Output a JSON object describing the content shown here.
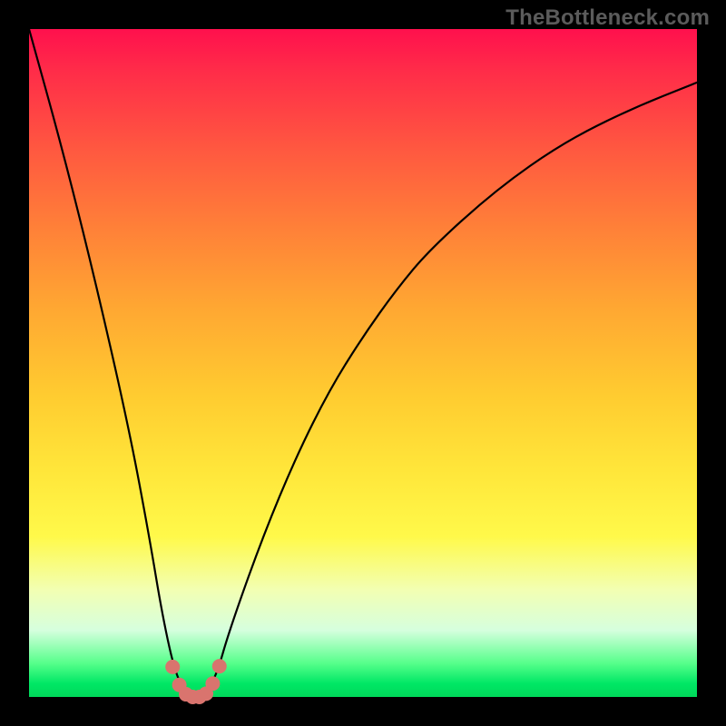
{
  "watermark_text": "TheBottleneck.com",
  "plot": {
    "background_frame_color": "#000000",
    "gradient_top_color": "#ff104d",
    "gradient_mid_color": "#ffe63a",
    "gradient_bottom_color": "#00d85a",
    "curve_color": "#000000",
    "marker_color": "#d9746e"
  },
  "chart_data": {
    "type": "line",
    "title": "",
    "xlabel": "",
    "ylabel": "",
    "x": [
      0.0,
      0.05,
      0.1,
      0.15,
      0.18,
      0.2,
      0.22,
      0.24,
      0.25,
      0.26,
      0.28,
      0.3,
      0.35,
      0.4,
      0.45,
      0.5,
      0.55,
      0.6,
      0.7,
      0.8,
      0.9,
      1.0
    ],
    "y_percent_bottleneck": [
      100,
      82,
      62,
      40,
      24,
      12,
      3,
      0,
      0,
      0,
      3,
      10,
      24,
      36,
      46,
      54,
      61,
      67,
      76,
      83,
      88,
      92
    ],
    "xlim": [
      0,
      1
    ],
    "ylim": [
      0,
      100
    ],
    "notes": "V-shaped bottleneck curve. Minimum (≈0% bottleneck) occurs around x≈0.24–0.26. Axes are unlabeled in the source image; x and y scales are normalized estimates read from the plot geometry.",
    "low_region_markers_x": [
      0.215,
      0.225,
      0.235,
      0.245,
      0.255,
      0.265,
      0.275,
      0.285
    ],
    "low_region_markers_y": [
      4.5,
      1.8,
      0.4,
      0.0,
      0.0,
      0.5,
      2.0,
      4.6
    ]
  }
}
